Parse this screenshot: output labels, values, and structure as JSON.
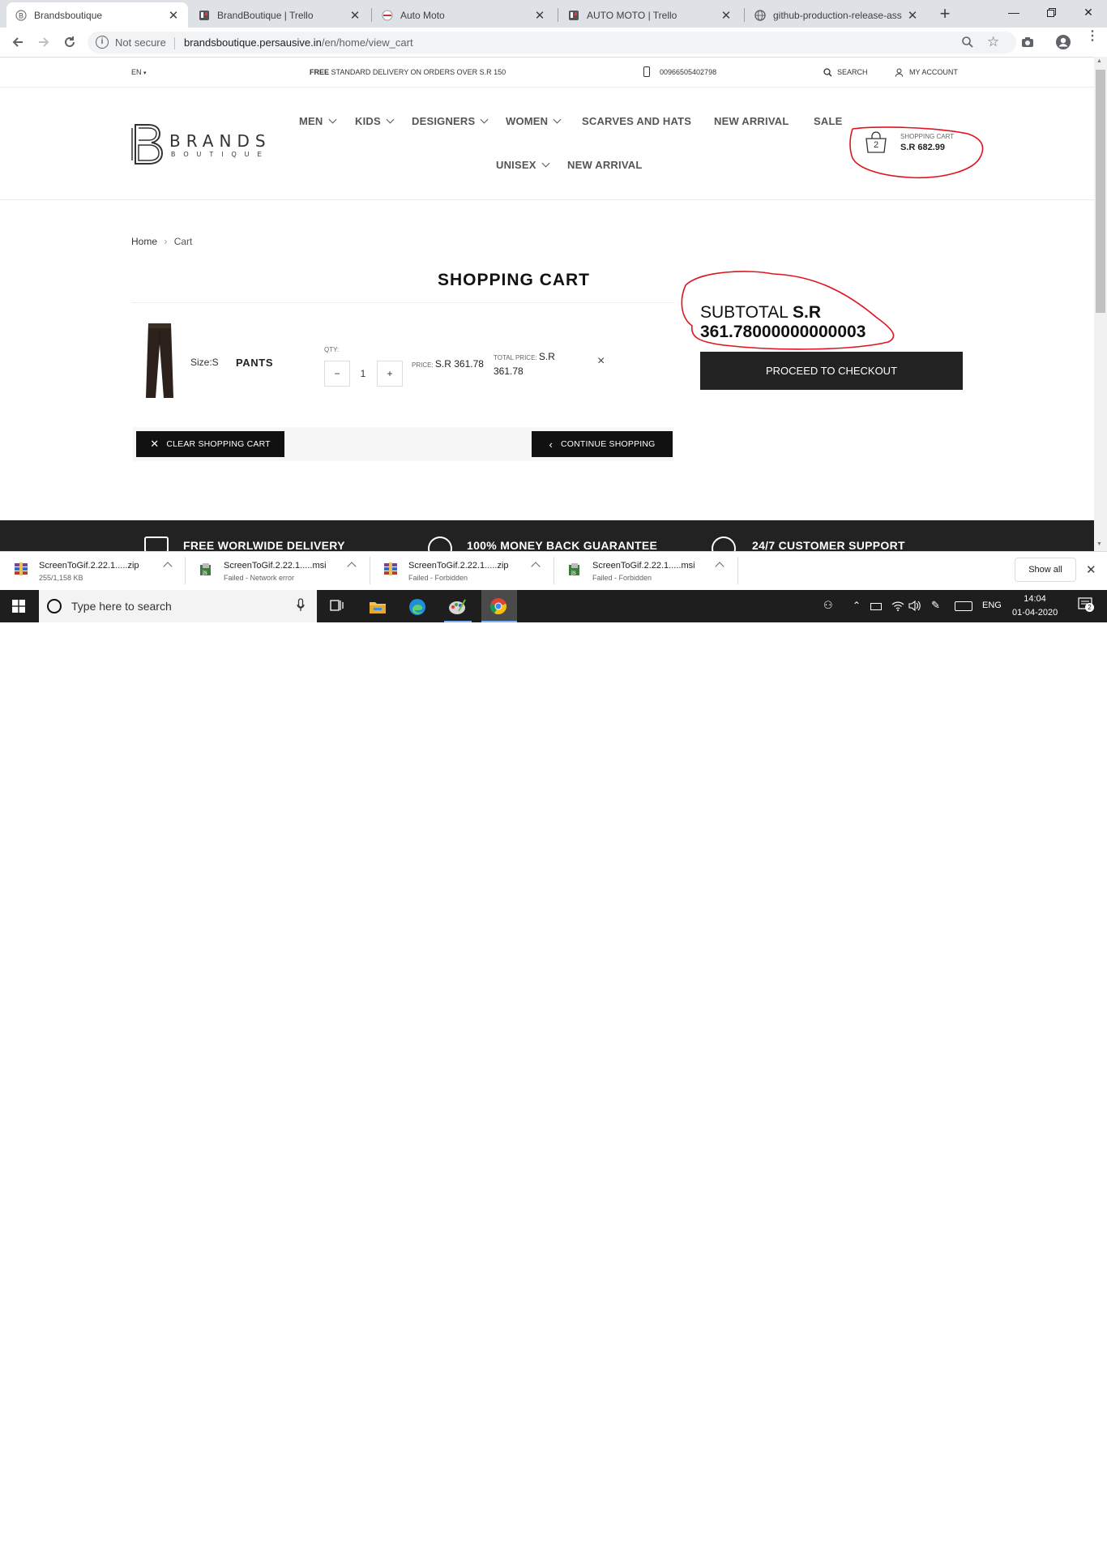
{
  "browser": {
    "tabs": [
      {
        "title": "Brandsboutique",
        "active": true
      },
      {
        "title": "BrandBoutique | Trello",
        "active": false
      },
      {
        "title": "Auto Moto",
        "active": false
      },
      {
        "title": "AUTO MOTO | Trello",
        "active": false
      },
      {
        "title": "github-production-release-ass",
        "active": false
      }
    ],
    "security_label": "Not secure",
    "url_host": "brandsboutique.persausive.in",
    "url_path": "/en/home/view_cart"
  },
  "site": {
    "language": "EN",
    "delivery_bold": "FREE",
    "delivery_rest": "STANDARD DELIVERY ON ORDERS OVER S.R 150",
    "phone": "00966505402798",
    "search_label": "SEARCH",
    "account_label": "MY ACCOUNT",
    "logo_main": "BRANDS",
    "logo_sub": "BOUTIQUE",
    "nav": {
      "men": "MEN",
      "kids": "KIDS",
      "designers": "DESIGNERS",
      "women": "WOMEN",
      "scarves": "SCARVES AND HATS",
      "new_arrival": "NEW ARRIVAL",
      "sale": "SALE",
      "unisex": "UNISEX",
      "new_arrival_2": "NEW ARRIVAL"
    },
    "cart": {
      "count": "2",
      "label": "SHOPPING CART",
      "amount": "S.R 682.99"
    }
  },
  "page": {
    "breadcrumb_home": "Home",
    "breadcrumb_sep": "›",
    "breadcrumb_current": "Cart",
    "title": "SHOPPING CART",
    "item": {
      "size": "Size:S",
      "name": "PANTS",
      "qty_label": "QTY:",
      "qty_minus": "−",
      "qty": "1",
      "qty_plus": "+",
      "price_label": "PRICE:",
      "price": "S.R 361.78",
      "total_label": "TOTAL PRICE:",
      "total_currency": "S.R",
      "total_value": "361.78",
      "remove": "×"
    },
    "subtotal_label": "SUBTOTAL",
    "subtotal_currency": "S.R",
    "subtotal_value": "361.78000000000003",
    "checkout_label": "PROCEED TO CHECKOUT",
    "clear_label": "CLEAR SHOPPING CART",
    "continue_label": "CONTINUE SHOPPING",
    "features": [
      "FREE WORLWIDE DELIVERY",
      "100% MONEY BACK GUARANTEE",
      "24/7 CUSTOMER SUPPORT"
    ]
  },
  "downloads": [
    {
      "name": "ScreenToGif.2.22.1.....zip",
      "status": "255/1,158 KB"
    },
    {
      "name": "ScreenToGif.2.22.1.....msi",
      "status": "Failed - Network error"
    },
    {
      "name": "ScreenToGif.2.22.1.....zip",
      "status": "Failed - Forbidden"
    },
    {
      "name": "ScreenToGif.2.22.1.....msi",
      "status": "Failed - Forbidden"
    }
  ],
  "downloads_show_all": "Show all",
  "taskbar": {
    "search_placeholder": "Type here to search",
    "language": "ENG",
    "time": "14:04",
    "date": "01-04-2020",
    "notifications": "2"
  },
  "colors": {
    "annotation_red": "#e0141e",
    "button_dark": "#222222"
  }
}
